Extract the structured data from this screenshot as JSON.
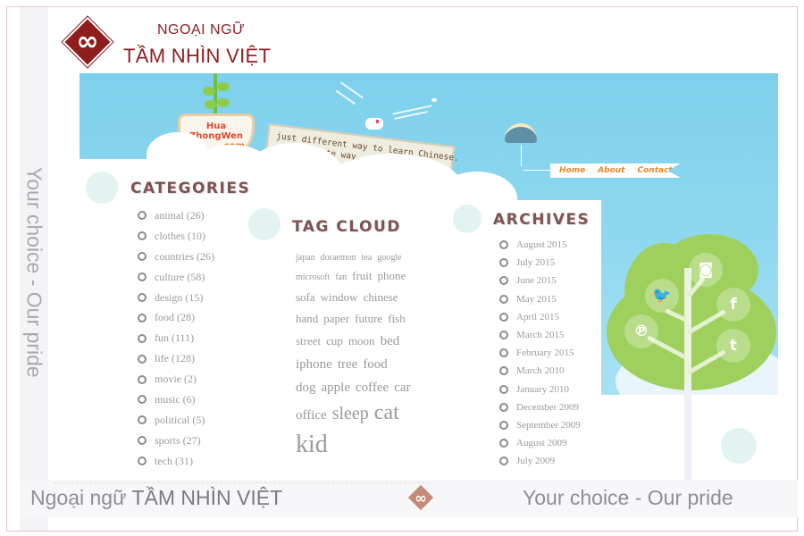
{
  "brand": {
    "top_line": "NGOẠI NGỮ",
    "main_line": "TẦM NHÌN VIỆT",
    "logo_glyph": "∞",
    "color": "#8f1d1f"
  },
  "side_slogan": "Your choice - Our pride",
  "banner": {
    "site_logo": {
      "line1": "Hua",
      "line2": "ZhongWen",
      "line3": ".com"
    },
    "slogan": [
      "just different way to learn Chinese.",
      "a fun & cute way."
    ],
    "nav": [
      {
        "label": "Home"
      },
      {
        "label": "About"
      },
      {
        "label": "Contact"
      }
    ]
  },
  "categories": {
    "title": "CATEGORIES",
    "items": [
      {
        "label": "animal (26)"
      },
      {
        "label": "clothes (10)"
      },
      {
        "label": "countries (26)"
      },
      {
        "label": "culture (58)"
      },
      {
        "label": "design (15)"
      },
      {
        "label": "food (28)"
      },
      {
        "label": "fun (111)"
      },
      {
        "label": "life (128)"
      },
      {
        "label": "movie (2)"
      },
      {
        "label": "music (6)"
      },
      {
        "label": "political (5)"
      },
      {
        "label": "sports (27)"
      },
      {
        "label": "tech (31)"
      }
    ]
  },
  "tag_cloud": {
    "title": "TAG CLOUD",
    "rows": [
      [
        {
          "label": "japan",
          "size": "xs"
        },
        {
          "label": "doraemon",
          "size": "xs"
        },
        {
          "label": "tea",
          "size": "xs"
        },
        {
          "label": "google",
          "size": "xs"
        }
      ],
      [
        {
          "label": "microsoft",
          "size": "xs"
        },
        {
          "label": "fan",
          "size": "xs"
        },
        {
          "label": "fruit",
          "size": "m"
        },
        {
          "label": "phone",
          "size": "m"
        }
      ],
      [
        {
          "label": "sofa",
          "size": "m"
        },
        {
          "label": "window",
          "size": "m"
        },
        {
          "label": "chinese",
          "size": "m"
        }
      ],
      [
        {
          "label": "hand",
          "size": "m"
        },
        {
          "label": "paper",
          "size": "m"
        },
        {
          "label": "future",
          "size": "m"
        },
        {
          "label": "fish",
          "size": "m"
        }
      ],
      [
        {
          "label": "street",
          "size": "m"
        },
        {
          "label": "cup",
          "size": "m"
        },
        {
          "label": "moon",
          "size": "m"
        },
        {
          "label": "bed",
          "size": "l"
        }
      ],
      [
        {
          "label": "iphone",
          "size": "l"
        },
        {
          "label": "tree",
          "size": "l"
        },
        {
          "label": "food",
          "size": "l"
        }
      ],
      [
        {
          "label": "dog",
          "size": "l"
        },
        {
          "label": "apple",
          "size": "l"
        },
        {
          "label": "coffee",
          "size": "l"
        },
        {
          "label": "car",
          "size": "l"
        }
      ],
      [
        {
          "label": "office",
          "size": "l"
        },
        {
          "label": "sleep",
          "size": "xl"
        },
        {
          "label": "cat",
          "size": "xxl"
        }
      ],
      [
        {
          "label": "kid",
          "size": "xxxl"
        }
      ]
    ]
  },
  "archives": {
    "title": "ARCHIVES",
    "items": [
      {
        "label": "August 2015"
      },
      {
        "label": "July 2015"
      },
      {
        "label": "June 2015"
      },
      {
        "label": "May 2015"
      },
      {
        "label": "April 2015"
      },
      {
        "label": "March 2015"
      },
      {
        "label": "February 2015"
      },
      {
        "label": "March 2010"
      },
      {
        "label": "January 2010"
      },
      {
        "label": "December 2009"
      },
      {
        "label": "September 2009"
      },
      {
        "label": "August 2009"
      },
      {
        "label": "July 2009"
      }
    ]
  },
  "social": [
    {
      "name": "instagram",
      "glyph": "◙"
    },
    {
      "name": "twitter",
      "glyph": "🐦"
    },
    {
      "name": "facebook",
      "glyph": "f"
    },
    {
      "name": "pinterest",
      "glyph": "℗"
    },
    {
      "name": "tumblr",
      "glyph": "t"
    }
  ],
  "footer": {
    "left_prefix": "Ngoại ngữ ",
    "left_brand": "TẦM NHÌN VIỆT",
    "logo_glyph": "∞",
    "right": "Your choice - Our pride"
  }
}
